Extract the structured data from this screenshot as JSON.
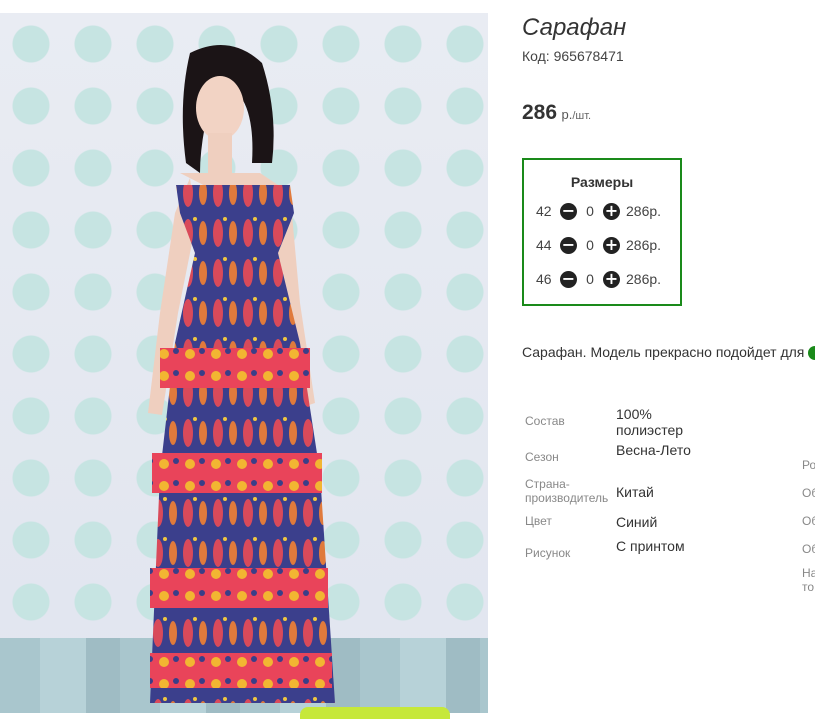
{
  "product": {
    "title": "Сарафан",
    "code": "Код: 965678471",
    "price": "286",
    "price_unit": "р.",
    "price_per": "/шт."
  },
  "sizes": {
    "title": "Размеры",
    "rows": [
      {
        "size": "42",
        "qty": "0",
        "price": "286р."
      },
      {
        "size": "44",
        "qty": "0",
        "price": "286р."
      },
      {
        "size": "46",
        "qty": "0",
        "price": "286р."
      }
    ],
    "minus_icon": "minus-circle-icon",
    "plus_icon": "plus-circle-icon"
  },
  "description": "Сарафан. Модель прекрасно подойдет для",
  "specs": [
    {
      "label": "Состав",
      "value": "100% полиэстер"
    },
    {
      "label": "Сезон",
      "value": "Весна-Лето"
    },
    {
      "label": "Страна-производитель",
      "value": "Китай"
    },
    {
      "label": "Цвет",
      "value": "Синий"
    },
    {
      "label": "Рисунок",
      "value": "С принтом"
    }
  ],
  "specs_right_labels": [
    "Ро",
    "Об",
    "Об",
    "Об",
    "На то"
  ],
  "colors": {
    "accent_border": "#1a8a1a",
    "cart_tab": "#c6e83a"
  }
}
